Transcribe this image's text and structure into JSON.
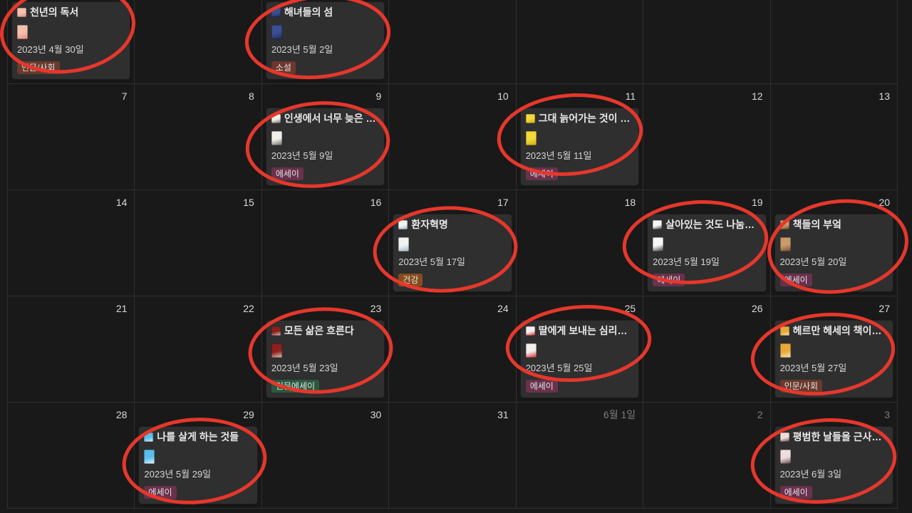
{
  "theme": {
    "background": "#191919",
    "grid_line": "#2f2f2f",
    "card": "#2f2f2f",
    "text": "#e9e9e9",
    "muted_text": "#7d7d7d",
    "annotation": "#e6372c"
  },
  "tag_palette": {
    "brown": "#6a3a2c",
    "red": "#6e3630",
    "pink": "#69314c",
    "orange": "#854c1d",
    "green": "#2b593f"
  },
  "calendar": {
    "weeks": [
      {
        "days": [
          {
            "events": [
              {
                "icon": "book-page-icon",
                "title": "천년의 독서",
                "date": "2023년 4월 30일",
                "tag": "인문/사회",
                "tag_color": "brown",
                "cover": [
                  "#f4c0ad",
                  "#e48d7f"
                ]
              }
            ]
          },
          {
            "events": []
          },
          {
            "events": [
              {
                "icon": "book-page-icon",
                "title": "해녀들의 섬",
                "date": "2023년 5월 2일",
                "tag": "소설",
                "tag_color": "red",
                "cover": [
                  "#3a4f93",
                  "#1f2b5e"
                ]
              }
            ]
          },
          {
            "events": []
          },
          {
            "events": []
          },
          {
            "events": []
          },
          {
            "events": []
          }
        ]
      },
      {
        "days": [
          {
            "label": "7",
            "events": []
          },
          {
            "label": "8",
            "events": []
          },
          {
            "label": "9",
            "events": [
              {
                "icon": "book-page-icon",
                "title": "인생에서 너무 늦은 …",
                "date": "2023년 5월 9일",
                "tag": "에세이",
                "tag_color": "pink",
                "cover": [
                  "#f1efe8",
                  "#6b6b64"
                ]
              }
            ]
          },
          {
            "label": "10",
            "events": []
          },
          {
            "label": "11",
            "events": [
              {
                "icon": "book-page-icon",
                "title": "그대 늙어가는 것이 …",
                "date": "2023년 5월 11일",
                "tag": "에세이",
                "tag_color": "pink",
                "cover": [
                  "#f2da3c",
                  "#c9a81a"
                ]
              }
            ]
          },
          {
            "label": "12",
            "events": []
          },
          {
            "label": "13",
            "events": []
          }
        ]
      },
      {
        "days": [
          {
            "label": "14",
            "events": []
          },
          {
            "label": "15",
            "events": []
          },
          {
            "label": "16",
            "events": []
          },
          {
            "label": "17",
            "events": [
              {
                "icon": "book-page-icon",
                "title": "환자혁명",
                "date": "2023년 5월 17일",
                "tag": "건강",
                "tag_color": "orange",
                "cover": [
                  "#eef3f2",
                  "#9fb6c0"
                ]
              }
            ]
          },
          {
            "label": "18",
            "events": []
          },
          {
            "label": "19",
            "events": [
              {
                "icon": "book-page-icon",
                "title": "살아있는 것도 나눔…",
                "date": "2023년 5월 19일",
                "tag": "에세이",
                "tag_color": "pink",
                "cover": [
                  "#f7f7f7",
                  "#3a3a3a"
                ]
              }
            ]
          },
          {
            "label": "20",
            "events": [
              {
                "icon": "book-page-icon",
                "title": "책들의 부엌",
                "date": "2023년 5월 20일",
                "tag": "에세이",
                "tag_color": "pink",
                "cover": [
                  "#c59b6a",
                  "#6e4a30"
                ]
              }
            ]
          }
        ]
      },
      {
        "days": [
          {
            "label": "21",
            "events": []
          },
          {
            "label": "22",
            "events": []
          },
          {
            "label": "23",
            "events": [
              {
                "icon": "book-page-icon",
                "title": "모든 삶은 흐른다",
                "date": "2023년 5월 23일",
                "tag": "인문에세이",
                "tag_color": "green",
                "cover": [
                  "#8e1f1f",
                  "#d9c8b8"
                ]
              }
            ]
          },
          {
            "label": "24",
            "events": []
          },
          {
            "label": "25",
            "events": [
              {
                "icon": "book-page-icon",
                "title": "딸에게 보내는 심리…",
                "date": "2023년 5월 25일",
                "tag": "에세이",
                "tag_color": "pink",
                "cover": [
                  "#f2eeee",
                  "#d42a2a"
                ]
              }
            ]
          },
          {
            "label": "26",
            "events": []
          },
          {
            "label": "27",
            "events": [
              {
                "icon": "book-page-icon",
                "title": "헤르만 헤세의 책이…",
                "date": "2023년 5월 27일",
                "tag": "인문/사회",
                "tag_color": "brown",
                "cover": [
                  "#e9a93a",
                  "#f5e6b8"
                ]
              }
            ]
          }
        ]
      },
      {
        "days": [
          {
            "label": "28",
            "events": []
          },
          {
            "label": "29",
            "events": [
              {
                "icon": "book-page-icon",
                "title": "나를 살게 하는 것들",
                "date": "2023년 5월 29일",
                "tag": "에세이",
                "tag_color": "pink",
                "cover": [
                  "#5bbde9",
                  "#e9f4fa"
                ]
              }
            ]
          },
          {
            "label": "30",
            "events": []
          },
          {
            "label": "31",
            "events": []
          },
          {
            "label": "6월 1일",
            "muted": true,
            "events": []
          },
          {
            "label": "2",
            "muted": true,
            "events": []
          },
          {
            "label": "3",
            "muted": true,
            "events": [
              {
                "icon": "book-page-icon",
                "title": "평범한 날들을 근사…",
                "date": "2023년 6월 3일",
                "tag": "에세이",
                "tag_color": "pink",
                "cover": [
                  "#f0dcdc",
                  "#5b4a4a"
                ]
              }
            ]
          }
        ]
      }
    ]
  }
}
